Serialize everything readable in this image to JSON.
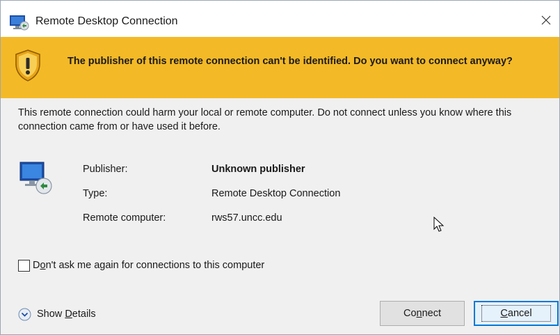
{
  "window": {
    "title": "Remote Desktop Connection",
    "close_glyph": "✕"
  },
  "banner": {
    "text": "The publisher of this remote connection can't be identified. Do you want to connect anyway?",
    "icon": "warning-shield-icon",
    "color": "#f4b926"
  },
  "warning": {
    "text": "This remote connection could harm your local or remote computer. Do not connect unless you know where this connection came from or have used it before."
  },
  "info": {
    "publisher_label": "Publisher:",
    "publisher_value": "Unknown publisher",
    "type_label": "Type:",
    "type_value": "Remote Desktop Connection",
    "computer_label": "Remote computer:",
    "computer_value": "rws57.uncc.edu"
  },
  "checkbox": {
    "label_pre": "D",
    "label_mnemonic": "o",
    "label_post": "n't ask me again for connections to this computer",
    "checked": false
  },
  "details": {
    "label_pre": "Show ",
    "label_mnemonic": "D",
    "label_post": "etails"
  },
  "buttons": {
    "connect_pre": "Co",
    "connect_mnemonic": "n",
    "connect_post": "nect",
    "cancel_mnemonic": "C",
    "cancel_post": "ancel"
  },
  "colors": {
    "accent": "#0078d7",
    "banner": "#f4b926"
  }
}
